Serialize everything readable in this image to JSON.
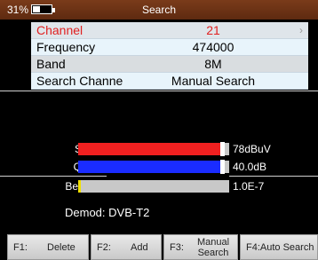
{
  "status": {
    "battery_percent": "31%",
    "title": "Search"
  },
  "menu": {
    "rows": [
      {
        "label": "Channel",
        "value": "21"
      },
      {
        "label": "Frequency",
        "value": "474000"
      },
      {
        "label": "Band",
        "value": "8M"
      },
      {
        "label": "Search Channe",
        "value": "Manual Search"
      }
    ]
  },
  "meters": [
    {
      "label": "S",
      "level": 0.94,
      "color": "#f02020",
      "value": "78dBuV"
    },
    {
      "label": "Q",
      "level": 0.94,
      "color": "#1a2cff",
      "value": "40.0dB"
    },
    {
      "label": "Ber",
      "level": 0.02,
      "color": "#f0e000",
      "value": "1.0E-7"
    }
  ],
  "demod": "Demod: DVB-T2",
  "function_keys": [
    {
      "key": "F1:",
      "label": "Delete"
    },
    {
      "key": "F2:",
      "label": "Add"
    },
    {
      "key": "F3:",
      "label": "Manual Search"
    },
    {
      "key": "",
      "label": "F4:Auto Search"
    }
  ],
  "icons": {
    "battery": "battery-icon",
    "chevron": "chevron-right-icon"
  }
}
